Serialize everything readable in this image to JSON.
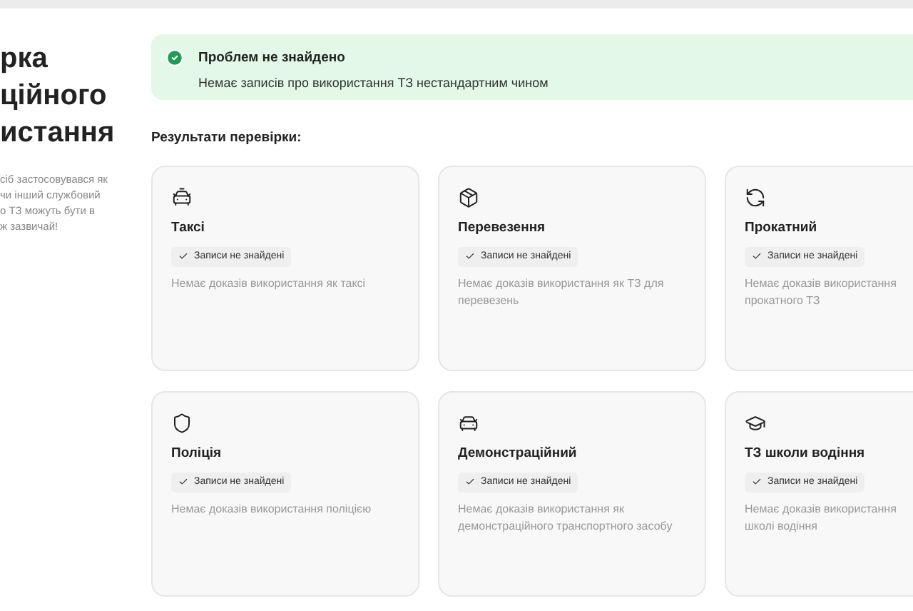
{
  "intro": {
    "heading_lines": [
      "рка",
      "ційного",
      "истання"
    ],
    "description_lines": [
      "сіб застосовувався як",
      "чи інший службовий",
      "о ТЗ можуть бути в",
      "ж зазвичай!"
    ]
  },
  "banner": {
    "kind": "success",
    "title": "Проблем не знайдено",
    "text": "Немає записів про використання ТЗ нестандартним чином"
  },
  "section_title": "Результати перевірки:",
  "cards": [
    {
      "kind": "taxi",
      "title": "Таксі",
      "badge": "Записи не знайдені",
      "text": "Немає доказів використання як таксі"
    },
    {
      "kind": "box",
      "title": "Перевезення",
      "badge": "Записи не знайдені",
      "text": "Немає доказів використання як ТЗ для перевезень"
    },
    {
      "kind": "swap",
      "title": "Прокатний",
      "badge": "Записи не знайдені",
      "text": "Немає доказів використання прокатного ТЗ"
    },
    {
      "kind": "shield",
      "title": "Поліція",
      "badge": "Записи не знайдені",
      "text": "Немає доказів використання поліцією"
    },
    {
      "kind": "car",
      "title": "Демонстраційний",
      "badge": "Записи не знайдені",
      "text": "Немає доказів використання як демонстраційного транспортного засобу"
    },
    {
      "kind": "cap",
      "title": "ТЗ школи водіння",
      "badge": "Записи не знайдені",
      "text": "Немає доказів використання школі водіння"
    }
  ]
}
